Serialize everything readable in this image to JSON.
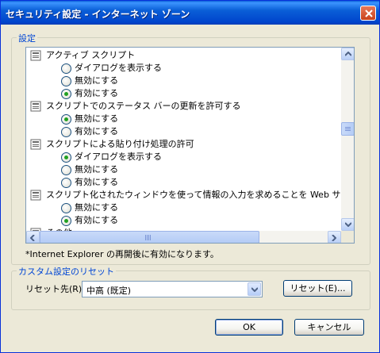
{
  "window": {
    "title": "セキュリティ設定 - インターネット ゾーン"
  },
  "settings": {
    "legend": "設定",
    "items": [
      {
        "kind": "header",
        "label": "アクティブ スクリプト"
      },
      {
        "kind": "option",
        "label": "ダイアログを表示する",
        "checked": false
      },
      {
        "kind": "option",
        "label": "無効にする",
        "checked": false
      },
      {
        "kind": "option",
        "label": "有効にする",
        "checked": true
      },
      {
        "kind": "header",
        "label": "スクリプトでのステータス バーの更新を許可する"
      },
      {
        "kind": "option",
        "label": "無効にする",
        "checked": true
      },
      {
        "kind": "option",
        "label": "有効にする",
        "checked": false
      },
      {
        "kind": "header",
        "label": "スクリプトによる貼り付け処理の許可"
      },
      {
        "kind": "option",
        "label": "ダイアログを表示する",
        "checked": true
      },
      {
        "kind": "option",
        "label": "無効にする",
        "checked": false
      },
      {
        "kind": "option",
        "label": "有効にする",
        "checked": false
      },
      {
        "kind": "header",
        "label": "スクリプト化されたウィンドウを使って情報の入力を求めることを Web サイトに"
      },
      {
        "kind": "option",
        "label": "無効にする",
        "checked": false
      },
      {
        "kind": "option",
        "label": "有効にする",
        "checked": true
      },
      {
        "kind": "header",
        "label": "その他"
      }
    ],
    "note": "*Internet Explorer の再開後に有効になります。"
  },
  "reset": {
    "legend": "カスタム設定のリセット",
    "label": "リセット先(R):",
    "selected": "中高 (既定)",
    "button": "リセット(E)..."
  },
  "buttons": {
    "ok": "OK",
    "cancel": "キャンセル"
  },
  "colors": {
    "title_bar": "#0a5fd7",
    "legend_text": "#0046d5",
    "dialog_bg": "#ece9d8",
    "radio_dot": "#21a121"
  }
}
